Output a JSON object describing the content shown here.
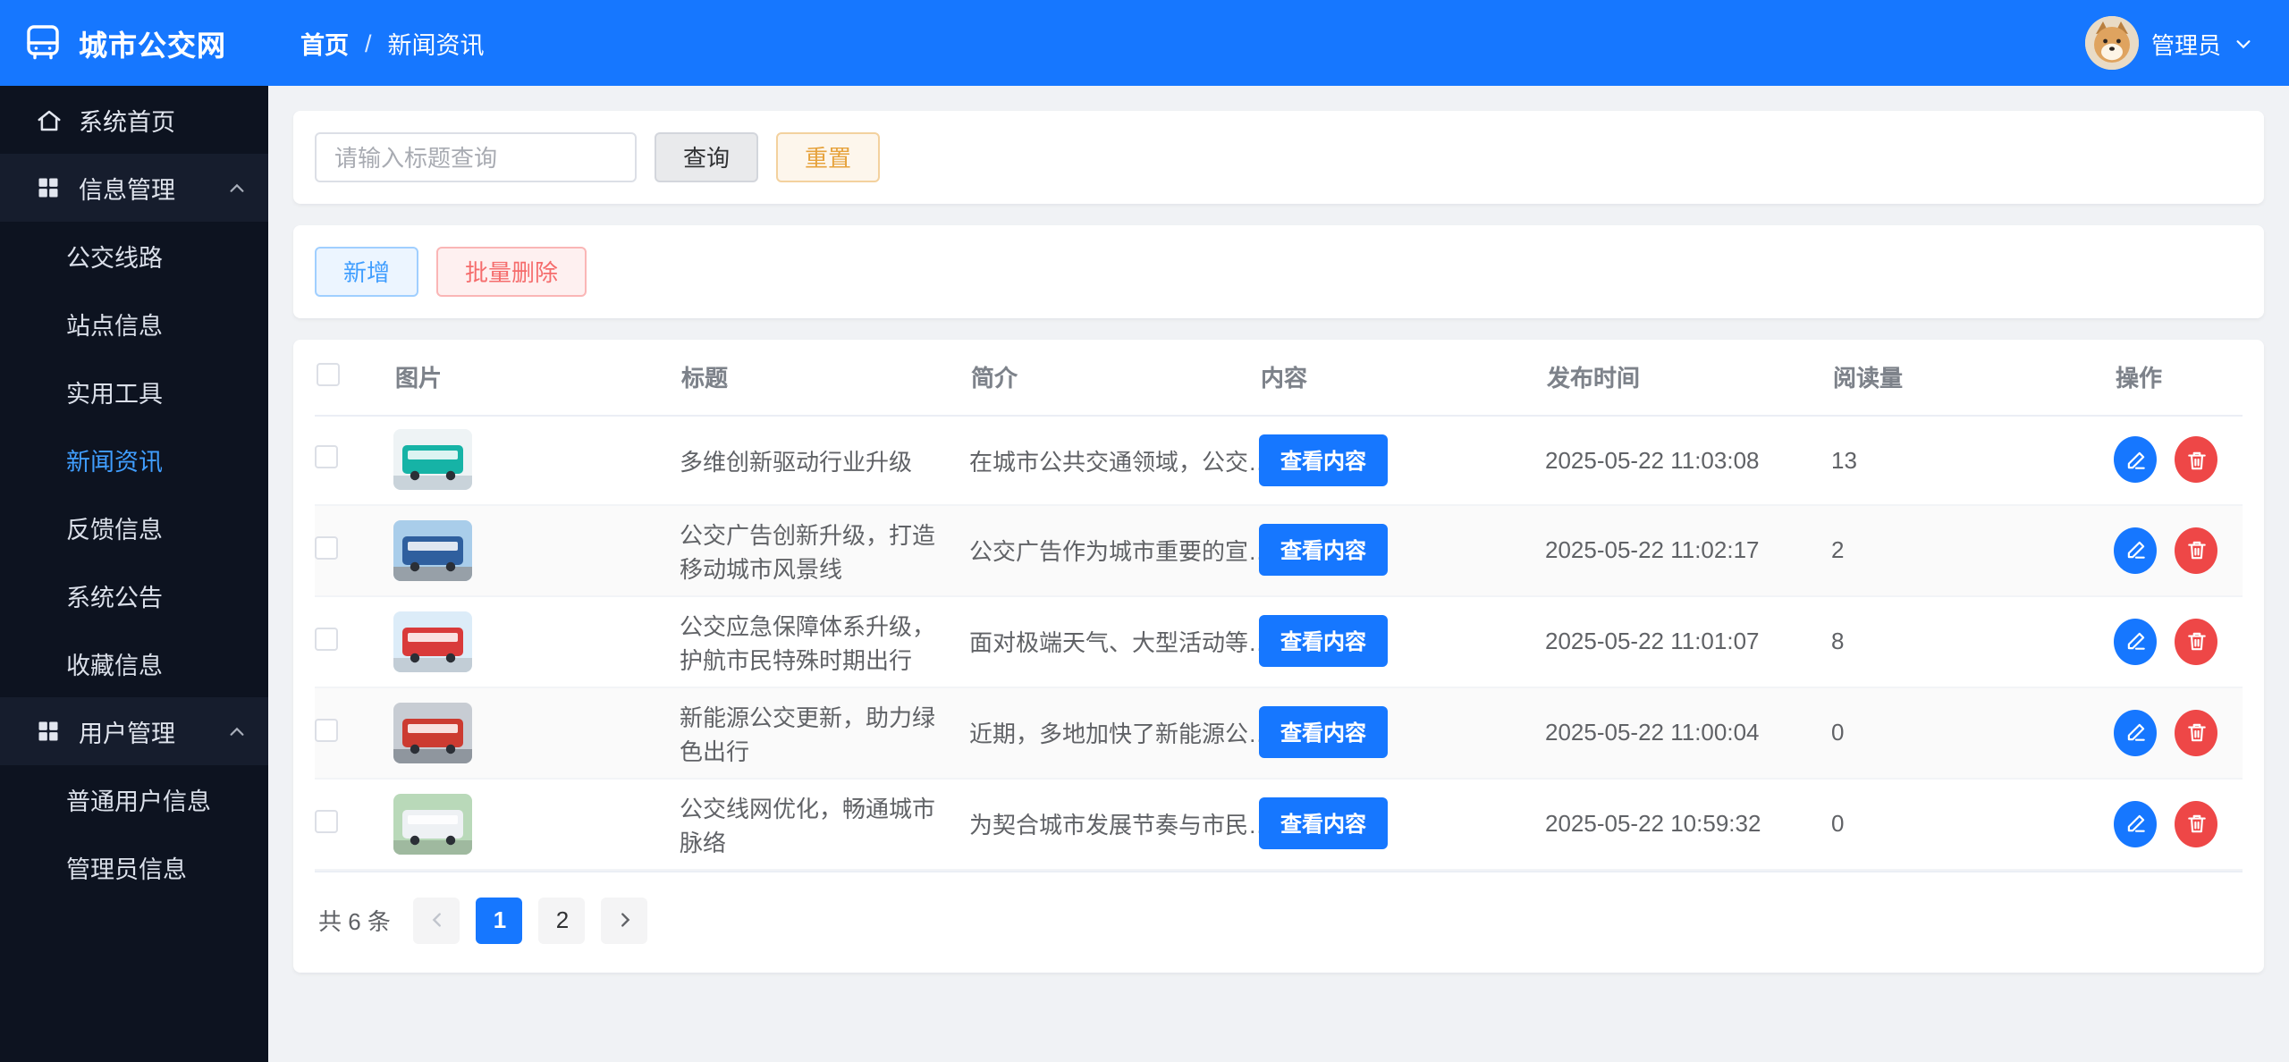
{
  "brand": {
    "title": "城市公交网"
  },
  "breadcrumb": {
    "items": [
      "首页",
      "新闻资讯"
    ],
    "separator": "/"
  },
  "user": {
    "name": "管理员"
  },
  "sidebar": {
    "groups": [
      {
        "label": "系统首页",
        "icon": "home-icon",
        "type": "link"
      },
      {
        "label": "信息管理",
        "icon": "grid-icon",
        "type": "group",
        "expanded": true,
        "children": [
          {
            "label": "公交线路",
            "active": false
          },
          {
            "label": "站点信息",
            "active": false
          },
          {
            "label": "实用工具",
            "active": false
          },
          {
            "label": "新闻资讯",
            "active": true
          },
          {
            "label": "反馈信息",
            "active": false
          },
          {
            "label": "系统公告",
            "active": false
          },
          {
            "label": "收藏信息",
            "active": false
          }
        ]
      },
      {
        "label": "用户管理",
        "icon": "grid-icon",
        "type": "group",
        "expanded": true,
        "children": [
          {
            "label": "普通用户信息",
            "active": false
          },
          {
            "label": "管理员信息",
            "active": false
          }
        ]
      }
    ]
  },
  "toolbar": {
    "search_placeholder": "请输入标题查询",
    "search_button": "查询",
    "reset_button": "重置",
    "add_button": "新增",
    "batch_delete_button": "批量删除"
  },
  "table": {
    "columns": [
      "图片",
      "标题",
      "简介",
      "内容",
      "发布时间",
      "阅读量",
      "操作"
    ],
    "view_content_button": "查看内容",
    "rows": [
      {
        "title": "多维创新驱动行业升级",
        "intro": "在城市公共交通领域，公交…",
        "publish_time": "2025-05-22 11:03:08",
        "reads": "13",
        "image": {
          "name": "bus-photo",
          "sky": "#eef3f5",
          "ground": "#c9d3da",
          "bus": "#16b3a6"
        }
      },
      {
        "title": "公交广告创新升级，打造移动城市风景线",
        "intro": "公交广告作为城市重要的宣…",
        "publish_time": "2025-05-22 11:02:17",
        "reads": "2",
        "image": {
          "name": "bus-photo",
          "sky": "#a9cdea",
          "ground": "#97a0a8",
          "bus": "#2f5f9e"
        }
      },
      {
        "title": "公交应急保障体系升级，护航市民特殊时期出行",
        "intro": "面对极端天气、大型活动等…",
        "publish_time": "2025-05-22 11:01:07",
        "reads": "8",
        "image": {
          "name": "bus-photo",
          "sky": "#dcecf8",
          "ground": "#c2cdd6",
          "bus": "#d93a3a"
        }
      },
      {
        "title": "新能源公交更新，助力绿色出行",
        "intro": "近期，多地加快了新能源公…",
        "publish_time": "2025-05-22 11:00:04",
        "reads": "0",
        "image": {
          "name": "bus-photo",
          "sky": "#c7ccd3",
          "ground": "#8f969e",
          "bus": "#cc3b31"
        }
      },
      {
        "title": "公交线网优化，畅通城市脉络",
        "intro": "为契合城市发展节奏与市民…",
        "publish_time": "2025-05-22 10:59:32",
        "reads": "0",
        "image": {
          "name": "bus-photo",
          "sky": "#b9d9b9",
          "ground": "#9fb99f",
          "bus": "#eef1f4"
        }
      }
    ]
  },
  "pagination": {
    "total": "共 6 条",
    "pages": [
      "1",
      "2"
    ],
    "active_page": "1"
  },
  "colors": {
    "accent": "#1677ff",
    "sidebar_bg": "#0d1320",
    "active_menu": "#409eff",
    "danger": "#ee4747"
  }
}
